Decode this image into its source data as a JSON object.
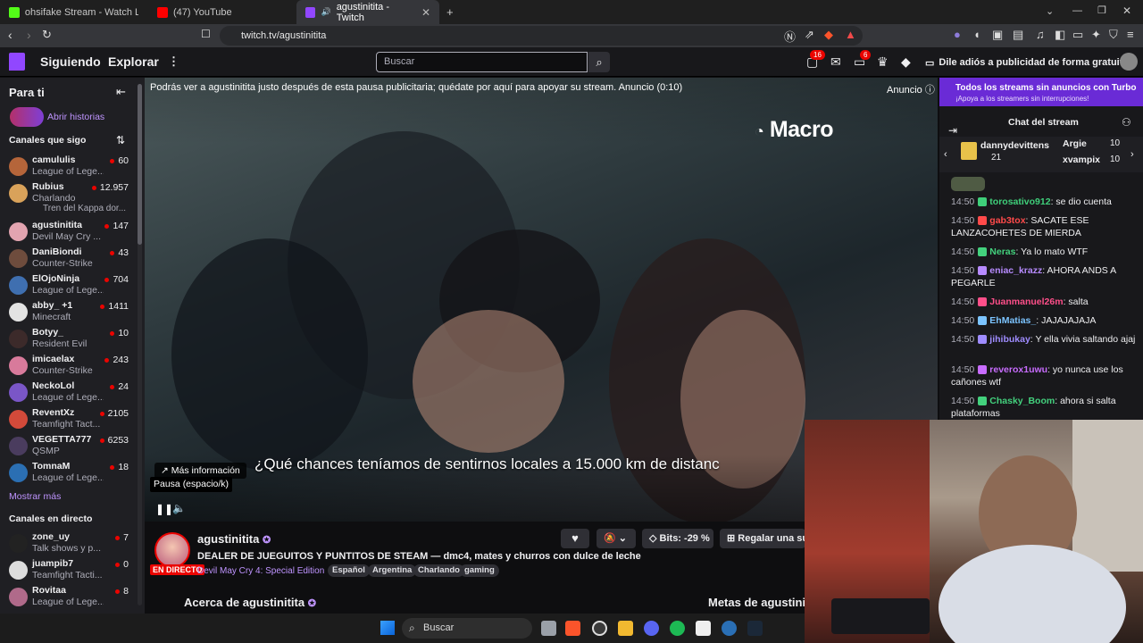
{
  "browser": {
    "tabs": [
      {
        "title": "ohsifake Stream - Watch Live on Kick"
      },
      {
        "title": "(47) YouTube"
      },
      {
        "title": "agustinitita - Twitch"
      }
    ],
    "url": "twitch.tv/agustinitita"
  },
  "topnav": {
    "following": "Siguiendo",
    "explore": "Explorar",
    "search_placeholder": "Buscar",
    "notif_count": "16",
    "whispers_count": "6",
    "ad_free": "Dile adiós a publicidad de forma gratuita"
  },
  "sidebar": {
    "for_you": "Para ti",
    "stories": "Abrir historias",
    "followed_header": "Canales que sigo",
    "followed": [
      {
        "name": "camululis",
        "game": "League of Lege...",
        "viewers": "60",
        "color": "#b5653a"
      },
      {
        "name": "Rubius",
        "game": "Charlando",
        "extra": "Tren del Kappa dor...",
        "viewers": "12.957",
        "color": "#d9a25a"
      },
      {
        "name": "agustinitita",
        "game": "Devil May Cry ...",
        "viewers": "147",
        "color": "#e2a4b0"
      },
      {
        "name": "DaniBiondi",
        "game": "Counter-Strike",
        "viewers": "43",
        "color": "#6e4c3d"
      },
      {
        "name": "ElOjoNinja",
        "game": "League of Lege...",
        "viewers": "704",
        "color": "#3f6fb0"
      },
      {
        "name": "abby_ +1",
        "game": "Minecraft",
        "viewers": "1411",
        "color": "#e3e3e3"
      },
      {
        "name": "Botyy_",
        "game": "Resident Evil",
        "viewers": "10",
        "color": "#3c2a2a"
      },
      {
        "name": "imicaelax",
        "game": "Counter-Strike",
        "viewers": "243",
        "color": "#d87a9b"
      },
      {
        "name": "NeckoLol",
        "game": "League of Lege...",
        "viewers": "24",
        "color": "#7a56c7"
      },
      {
        "name": "ReventXz",
        "game": "Teamfight Tact...",
        "viewers": "2105",
        "color": "#d34a3a"
      },
      {
        "name": "VEGETTA777",
        "game": "QSMP",
        "viewers": "6253",
        "color": "#4a3c5e"
      },
      {
        "name": "TomnaM",
        "game": "League of Lege...",
        "viewers": "18",
        "color": "#2b6fb3"
      }
    ],
    "show_more": "Mostrar más",
    "live_header": "Canales en directo",
    "live": [
      {
        "name": "zone_uy",
        "game": "Talk shows y p...",
        "viewers": "7",
        "color": "#222"
      },
      {
        "name": "juampib7",
        "game": "Teamfight Tacti...",
        "viewers": "0",
        "color": "#ddd"
      },
      {
        "name": "Rovitaa",
        "game": "League of Lege...",
        "viewers": "8",
        "color": "#b06a8a"
      }
    ]
  },
  "player": {
    "ad_notice": "Podrás ver a agustinitita justo después de esta pausa publicitaria; quédate por aquí para apoyar su stream. Anuncio (0:10)",
    "ad_label": "Anuncio",
    "brand": "Macro",
    "subtitle": "¿Qué chances teníamos de sentirnos locales a 15.000 km de distanc",
    "more_info": "Más información",
    "pause_tip": "Pausa (espacio/k)"
  },
  "stream": {
    "name": "agustinitita",
    "live": "EN DIRECTO",
    "title": "DEALER DE JUEGUITOS Y PUNTITOS DE STEAM — dmc4, mates y churros con dulce de leche",
    "game": "Devil May Cry 4: Special Edition",
    "tags": [
      "Español",
      "Argentina",
      "Charlando",
      "gaming"
    ],
    "bits": "Bits: -29 %",
    "gift": "Regalar una sub",
    "about": "Acerca de agustinitita",
    "goals": "Metas de agustinitita"
  },
  "chat": {
    "turbo_title": "Todos los streams sin anuncios con Turbo",
    "turbo_sub": "¡Apoya a los streamers sin interrupciones!",
    "title": "Chat del stream",
    "gifters": [
      {
        "name": "dannydevittens",
        "count": "21"
      },
      {
        "name": "Argie",
        "count": "10"
      },
      {
        "name": "xvampix",
        "count": "10"
      }
    ],
    "messages": [
      {
        "time": "14:50",
        "user": "torosativo912",
        "color": "#3fcf7a",
        "text": "se dio cuenta"
      },
      {
        "time": "14:50",
        "user": "gab3tox",
        "color": "#ff4a4a",
        "text": "SACATE ESE LANZACOHETES DE MIERDA"
      },
      {
        "time": "14:50",
        "user": "Neras",
        "color": "#43d17d",
        "text": "Ya lo mato WTF"
      },
      {
        "time": "14:50",
        "user": "eniac_krazz",
        "color": "#b78bff",
        "text": "AHORA ANDS A PEGARLE"
      },
      {
        "time": "14:50",
        "user": "Juanmanuel26m",
        "color": "#ff4f8a",
        "text": "salta"
      },
      {
        "time": "14:50",
        "user": "EhMatias_",
        "color": "#7cc4ff",
        "text": "JAJAJAJAJA"
      },
      {
        "time": "14:50",
        "user": "jihibukay",
        "color": "#9f8cff",
        "text": "Y ella vivia saltando ajaj"
      },
      {
        "time": "14:50",
        "user": "reverox1uwu",
        "color": "#c86cff",
        "text": "yo nunca use los cañones wtf"
      },
      {
        "time": "14:50",
        "user": "Chasky_Boom",
        "color": "#43d17d",
        "text": "ahora si salta plataformas"
      }
    ]
  },
  "taskbar": {
    "search": "Buscar"
  }
}
